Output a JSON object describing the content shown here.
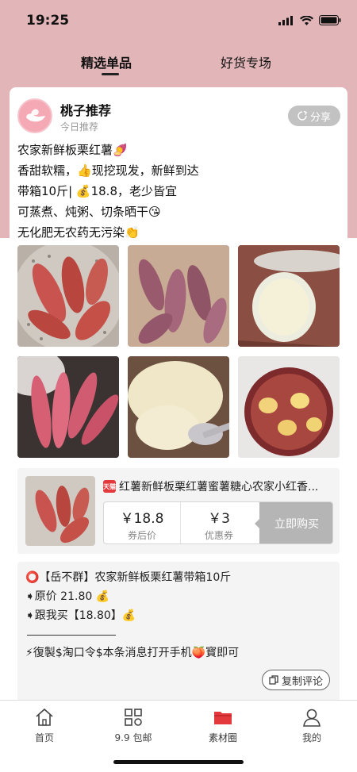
{
  "status": {
    "time": "19:25"
  },
  "tabs": [
    {
      "label": "精选单品"
    },
    {
      "label": "好货专场"
    }
  ],
  "post": {
    "author": "桃子推荐",
    "subtitle": "今日推荐",
    "share_label": "分享",
    "lines": [
      "农家新鲜板栗红薯🍠",
      "香甜软糯，👍现挖现发，新鲜到达",
      "带箱10斤| 💰18.8，老少皆宜",
      "可蒸煮、炖粥、切条晒干😘",
      "无化肥无农药无污染👏"
    ]
  },
  "product": {
    "badge": "天猫",
    "title": "红薯新鲜板栗红薯蜜薯糖心农家小红香...",
    "price": "￥18.8",
    "price_label": "券后价",
    "coupon": "￥3",
    "coupon_label": "优惠券",
    "buy_label": "立即购买"
  },
  "comment": {
    "lines": [
      "⭕【岳不群】农家新鲜板栗红薯带箱10斤",
      "➧原价 21.80 💰",
      "➧跟我买【18.80】💰"
    ],
    "footer": "⚡復製$淘口令$本条消息打开手机🍑寳即可",
    "copy_label": "复制评论"
  },
  "bottom_nav": [
    {
      "label": "首页",
      "icon": "home-icon"
    },
    {
      "label": "9.9 包邮",
      "icon": "grid-icon"
    },
    {
      "label": "素材圈",
      "icon": "folder-icon"
    },
    {
      "label": "我的",
      "icon": "user-icon"
    }
  ],
  "colors": {
    "header_bg": "#e2b6b8",
    "active_nav": "#e4393c",
    "button_gray": "#b5b5b5"
  }
}
